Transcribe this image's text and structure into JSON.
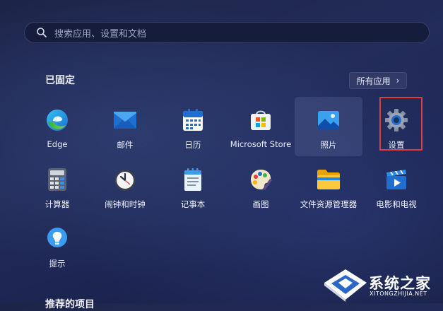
{
  "search": {
    "placeholder": "搜索应用、设置和文档",
    "icon": "search-icon"
  },
  "pinned": {
    "title": "已固定",
    "all_apps_label": "所有应用",
    "all_apps_chevron": "›"
  },
  "apps": [
    {
      "label": "Edge",
      "icon": "edge-icon"
    },
    {
      "label": "邮件",
      "icon": "mail-icon"
    },
    {
      "label": "日历",
      "icon": "calendar-icon"
    },
    {
      "label": "Microsoft Store",
      "icon": "store-icon"
    },
    {
      "label": "照片",
      "icon": "photos-icon"
    },
    {
      "label": "设置",
      "icon": "gear-icon"
    },
    {
      "label": "计算器",
      "icon": "calculator-icon"
    },
    {
      "label": "闹钟和时钟",
      "icon": "clock-icon"
    },
    {
      "label": "记事本",
      "icon": "notepad-icon"
    },
    {
      "label": "画图",
      "icon": "paint-icon"
    },
    {
      "label": "文件资源管理器",
      "icon": "folder-icon"
    },
    {
      "label": "电影和电视",
      "icon": "movies-icon"
    },
    {
      "label": "提示",
      "icon": "tips-icon"
    }
  ],
  "recommended": {
    "title": "推荐的项目"
  },
  "watermark": {
    "name": "系统之家",
    "url": "XITONGZHIJIA.NET"
  },
  "colors": {
    "highlight": "#e23c3c",
    "accent": "#1f6fd1"
  }
}
